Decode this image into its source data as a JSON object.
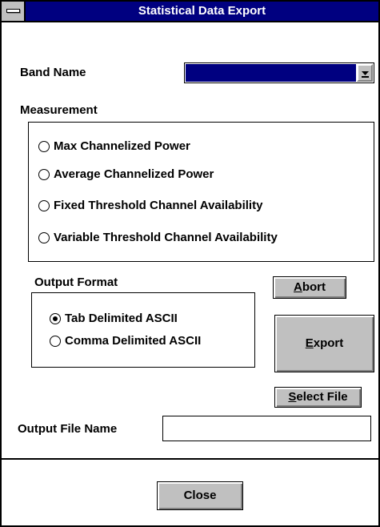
{
  "window": {
    "title": "Statistical Data Export"
  },
  "band": {
    "label": "Band Name",
    "selected": ""
  },
  "measurement": {
    "label": "Measurement",
    "options": [
      {
        "label": "Max Channelized Power",
        "checked": false
      },
      {
        "label": "Average Channelized Power",
        "checked": false
      },
      {
        "label": "Fixed Threshold Channel Availability",
        "checked": false
      },
      {
        "label": "Variable Threshold Channel Availability",
        "checked": false
      }
    ]
  },
  "output_format": {
    "label": "Output Format",
    "options": [
      {
        "label": "Tab Delimited ASCII",
        "checked": true
      },
      {
        "label": "Comma Delimited ASCII",
        "checked": false
      }
    ]
  },
  "buttons": {
    "abort": {
      "mnemonic": "A",
      "rest": "bort"
    },
    "export": {
      "mnemonic": "E",
      "rest": "xport"
    },
    "select_file": {
      "mnemonic": "S",
      "rest": "elect File"
    },
    "close": "Close"
  },
  "output_file": {
    "label": "Output File Name",
    "value": ""
  },
  "colors": {
    "title_bar": "#000080",
    "button_face": "#c0c0c0",
    "selection": "#000080"
  }
}
